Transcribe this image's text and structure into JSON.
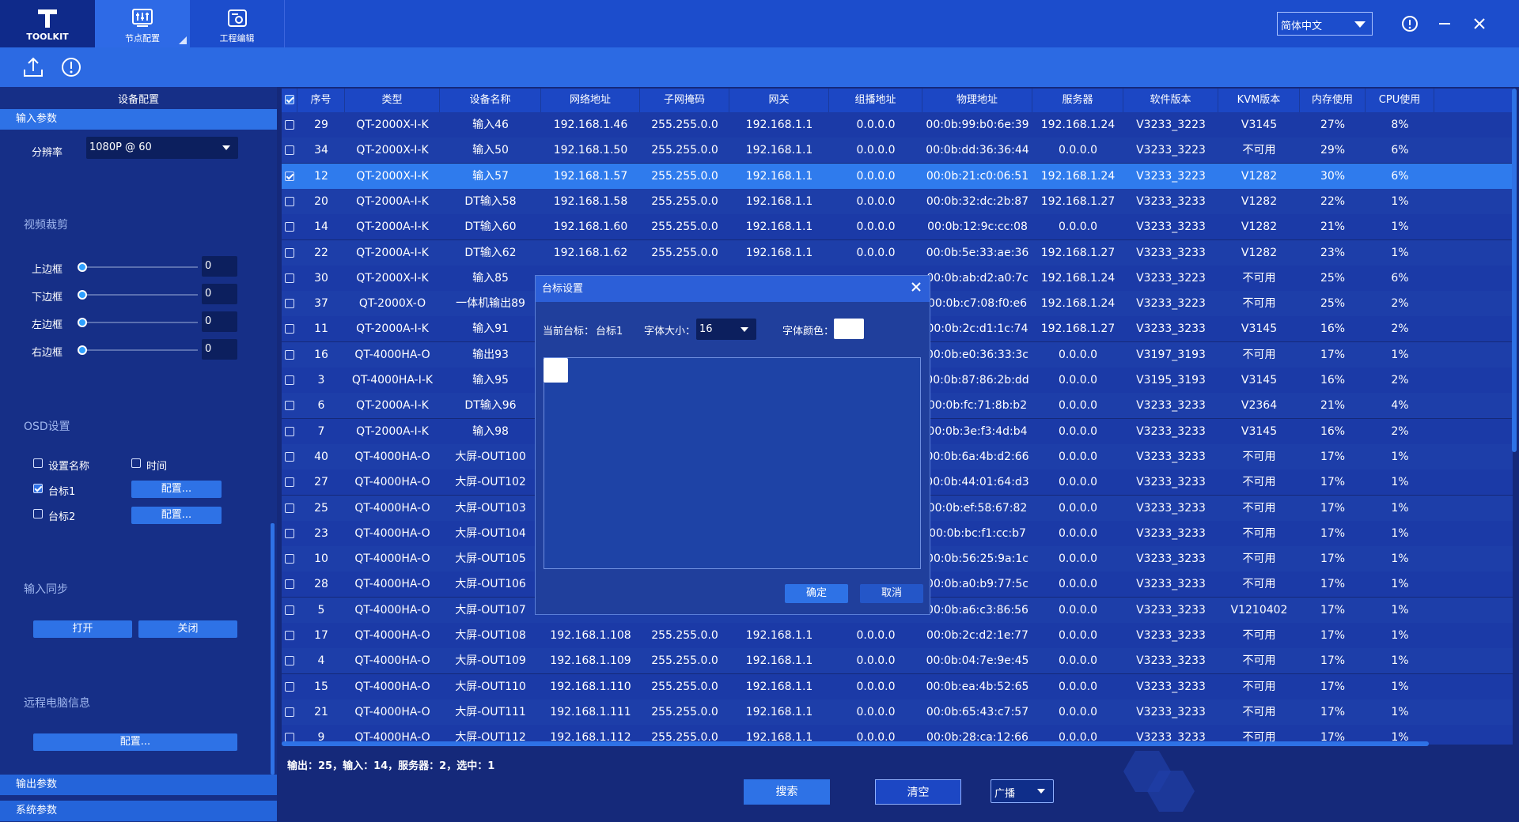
{
  "nav": {
    "toolkit": "TOOLKIT",
    "node_config": "节点配置",
    "project_edit": "工程编辑"
  },
  "lang": "简体中文",
  "sidebar": {
    "device_config": "设备配置",
    "input_params": "输入参数",
    "resolution_label": "分辨率",
    "resolution_value": "1080P @ 60",
    "video_crop": "视频裁剪",
    "crop": [
      {
        "label": "上边框",
        "value": "0"
      },
      {
        "label": "下边框",
        "value": "0"
      },
      {
        "label": "左边框",
        "value": "0"
      },
      {
        "label": "右边框",
        "value": "0"
      }
    ],
    "osd": "OSD设置",
    "osd_name": "设置名称",
    "osd_time": "时间",
    "logo1": "台标1",
    "logo2": "台标2",
    "config1": "配置...",
    "config2": "配置...",
    "input_sync": "输入同步",
    "open": "打开",
    "close": "关闭",
    "remote_info": "远程电脑信息",
    "remote_config": "配置...",
    "output_params": "输出参数",
    "system_params": "系统参数"
  },
  "table": {
    "headers": [
      "序号",
      "类型",
      "设备名称",
      "网络地址",
      "子网掩码",
      "网关",
      "组播地址",
      "物理地址",
      "服务器",
      "软件版本",
      "KVM版本",
      "内存使用",
      "CPU使用"
    ],
    "rows": [
      [
        "29",
        "QT-2000X-I-K",
        "输入46",
        "192.168.1.46",
        "255.255.0.0",
        "192.168.1.1",
        "0.0.0.0",
        "00:0b:99:b0:6e:39",
        "192.168.1.24",
        "V3233_3223",
        "V3145",
        "27%",
        "8%"
      ],
      [
        "34",
        "QT-2000X-I-K",
        "输入50",
        "192.168.1.50",
        "255.255.0.0",
        "192.168.1.1",
        "0.0.0.0",
        "00:0b:dd:36:36:44",
        "0.0.0.0",
        "V3233_3223",
        "不可用",
        "29%",
        "6%"
      ],
      [
        "12",
        "QT-2000X-I-K",
        "输入57",
        "192.168.1.57",
        "255.255.0.0",
        "192.168.1.1",
        "0.0.0.0",
        "00:0b:21:c0:06:51",
        "192.168.1.24",
        "V3233_3223",
        "V1282",
        "30%",
        "6%"
      ],
      [
        "20",
        "QT-2000A-I-K",
        "DT输入58",
        "192.168.1.58",
        "255.255.0.0",
        "192.168.1.1",
        "0.0.0.0",
        "00:0b:32:dc:2b:87",
        "192.168.1.27",
        "V3233_3233",
        "V1282",
        "22%",
        "1%"
      ],
      [
        "14",
        "QT-2000A-I-K",
        "DT输入60",
        "192.168.1.60",
        "255.255.0.0",
        "192.168.1.1",
        "0.0.0.0",
        "00:0b:12:9c:cc:08",
        "0.0.0.0",
        "V3233_3233",
        "V1282",
        "21%",
        "1%"
      ],
      [
        "22",
        "QT-2000A-I-K",
        "DT输入62",
        "192.168.1.62",
        "255.255.0.0",
        "192.168.1.1",
        "0.0.0.0",
        "00:0b:5e:33:ae:36",
        "192.168.1.27",
        "V3233_3233",
        "V1282",
        "23%",
        "1%"
      ],
      [
        "30",
        "QT-2000X-I-K",
        "输入85",
        "",
        "",
        "",
        "",
        "00:0b:ab:d2:a0:7c",
        "192.168.1.24",
        "V3233_3223",
        "不可用",
        "25%",
        "6%"
      ],
      [
        "37",
        "QT-2000X-O",
        "一体机输出89",
        "",
        "",
        "",
        "",
        "00:0b:c7:08:f0:e6",
        "192.168.1.24",
        "V3233_3223",
        "不可用",
        "25%",
        "2%"
      ],
      [
        "11",
        "QT-2000A-I-K",
        "输入91",
        "",
        "",
        "",
        "",
        "00:0b:2c:d1:1c:74",
        "192.168.1.27",
        "V3233_3233",
        "V3145",
        "16%",
        "2%"
      ],
      [
        "16",
        "QT-4000HA-O",
        "输出93",
        "",
        "",
        "",
        "",
        "00:0b:e0:36:33:3c",
        "0.0.0.0",
        "V3197_3193",
        "不可用",
        "17%",
        "1%"
      ],
      [
        "3",
        "QT-4000HA-I-K",
        "输入95",
        "",
        "",
        "",
        "",
        "00:0b:87:86:2b:dd",
        "0.0.0.0",
        "V3195_3193",
        "V3145",
        "16%",
        "2%"
      ],
      [
        "6",
        "QT-2000A-I-K",
        "DT输入96",
        "",
        "",
        "",
        "",
        "00:0b:fc:71:8b:b2",
        "0.0.0.0",
        "V3233_3233",
        "V2364",
        "21%",
        "4%"
      ],
      [
        "7",
        "QT-2000A-I-K",
        "输入98",
        "",
        "",
        "",
        "",
        "00:0b:3e:f3:4d:b4",
        "0.0.0.0",
        "V3233_3233",
        "V3145",
        "16%",
        "2%"
      ],
      [
        "40",
        "QT-4000HA-O",
        "大屏-OUT100",
        "",
        "",
        "",
        "",
        "00:0b:6a:4b:d2:66",
        "0.0.0.0",
        "V3233_3233",
        "不可用",
        "17%",
        "1%"
      ],
      [
        "27",
        "QT-4000HA-O",
        "大屏-OUT102",
        "",
        "",
        "",
        "",
        "00:0b:44:01:64:d3",
        "0.0.0.0",
        "V3233_3233",
        "不可用",
        "17%",
        "1%"
      ],
      [
        "25",
        "QT-4000HA-O",
        "大屏-OUT103",
        "",
        "",
        "",
        "",
        "00:0b:ef:58:67:82",
        "0.0.0.0",
        "V3233_3233",
        "不可用",
        "17%",
        "1%"
      ],
      [
        "23",
        "QT-4000HA-O",
        "大屏-OUT104",
        "",
        "",
        "",
        "",
        "00:0b:bc:f1:cc:b7",
        "0.0.0.0",
        "V3233_3233",
        "不可用",
        "17%",
        "1%"
      ],
      [
        "10",
        "QT-4000HA-O",
        "大屏-OUT105",
        "",
        "",
        "",
        "",
        "00:0b:56:25:9a:1c",
        "0.0.0.0",
        "V3233_3233",
        "不可用",
        "17%",
        "1%"
      ],
      [
        "28",
        "QT-4000HA-O",
        "大屏-OUT106",
        "",
        "",
        "",
        "",
        "00:0b:a0:b9:77:5c",
        "0.0.0.0",
        "V3233_3233",
        "不可用",
        "17%",
        "1%"
      ],
      [
        "5",
        "QT-4000HA-O",
        "大屏-OUT107",
        "",
        "",
        "",
        "",
        "00:0b:a6:c3:86:56",
        "0.0.0.0",
        "V3233_3233",
        "V1210402",
        "17%",
        "1%"
      ],
      [
        "17",
        "QT-4000HA-O",
        "大屏-OUT108",
        "192.168.1.108",
        "255.255.0.0",
        "192.168.1.1",
        "0.0.0.0",
        "00:0b:2c:d2:1e:77",
        "0.0.0.0",
        "V3233_3233",
        "不可用",
        "17%",
        "1%"
      ],
      [
        "4",
        "QT-4000HA-O",
        "大屏-OUT109",
        "192.168.1.109",
        "255.255.0.0",
        "192.168.1.1",
        "0.0.0.0",
        "00:0b:04:7e:9e:45",
        "0.0.0.0",
        "V3233_3233",
        "不可用",
        "17%",
        "1%"
      ],
      [
        "15",
        "QT-4000HA-O",
        "大屏-OUT110",
        "192.168.1.110",
        "255.255.0.0",
        "192.168.1.1",
        "0.0.0.0",
        "00:0b:ea:4b:52:65",
        "0.0.0.0",
        "V3233_3233",
        "不可用",
        "17%",
        "1%"
      ],
      [
        "21",
        "QT-4000HA-O",
        "大屏-OUT111",
        "192.168.1.111",
        "255.255.0.0",
        "192.168.1.1",
        "0.0.0.0",
        "00:0b:65:43:c7:57",
        "0.0.0.0",
        "V3233_3233",
        "不可用",
        "17%",
        "1%"
      ],
      [
        "9",
        "QT-4000HA-O",
        "大屏-OUT112",
        "192.168.1.112",
        "255.255.0.0",
        "192.168.1.1",
        "0.0.0.0",
        "00:0b:28:ca:12:66",
        "0.0.0.0",
        "V3233_3233",
        "不可用",
        "17%",
        "1%"
      ]
    ],
    "selected_index": 2
  },
  "status": "输出：25，输入：14，服务器：2，选中：1",
  "bottom": {
    "search": "搜索",
    "clear": "清空",
    "mode": "广播"
  },
  "dialog": {
    "title": "台标设置",
    "current_label": "当前台标：",
    "current_value": "台标1",
    "font_size_label": "字体大小：",
    "font_size_value": "16",
    "font_color_label": "字体颜色：",
    "ok": "确定",
    "cancel": "取消"
  },
  "colors": {
    "accent": "#2e72e6",
    "selected_row": "#2f7bed",
    "top_bar": "#1c4dcc"
  }
}
